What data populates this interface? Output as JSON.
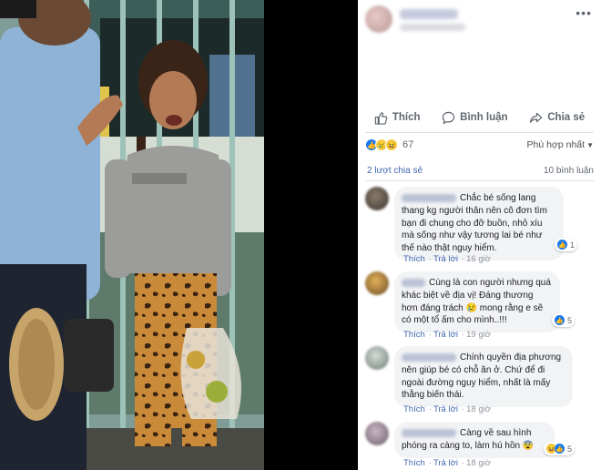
{
  "post": {
    "more_icon": "ellipsis-icon"
  },
  "actions": {
    "like_label": "Thích",
    "comment_label": "Bình luận",
    "share_label": "Chia sẻ"
  },
  "reactions": {
    "types": [
      "like",
      "sad",
      "haha"
    ],
    "count": "67",
    "sort_label": "Phù hợp nhất"
  },
  "stats": {
    "shares": "2 lượt chia sẻ",
    "comments": "10 bình luận"
  },
  "comments": [
    {
      "text": "Chắc bé sống lang thang kg người thân nên cô đơn tìm bạn đi chung cho đỡ buồn, nhỏ xíu mà sống như vậy tương lai bé như thế nào thật nguy hiểm.",
      "like": "Thích",
      "reply": "Trả lời",
      "time": "16 giờ",
      "reaction_count": "1"
    },
    {
      "text_1": "Cùng là con người nhưng quá khác biệt về địa vị! Đáng thương hơn đáng trách",
      "emoji": "😢",
      "text_2": "mong rằng e sẽ có một tổ ấm cho mình..!!!",
      "like": "Thích",
      "reply": "Trả lời",
      "time": "19 giờ",
      "reaction_count": "5"
    },
    {
      "text": "Chính quyền địa phương nên giúp bé có chỗ ăn ở. Chứ để đi ngoài đường nguy hiểm, nhất là mấy thằng biến thái.",
      "like": "Thích",
      "reply": "Trả lời",
      "time": "18 giờ"
    },
    {
      "text": "Càng về sau hình phóng ra càng to, làm hú hồn",
      "emoji": "😨",
      "like": "Thích",
      "reply": "Trả lời",
      "time": "18 giờ",
      "reaction_count": "5"
    }
  ],
  "colors": {
    "link": "#4267b2",
    "like_blue": "#1877f2",
    "bubble": "#f2f3f5",
    "muted": "#90949c"
  }
}
